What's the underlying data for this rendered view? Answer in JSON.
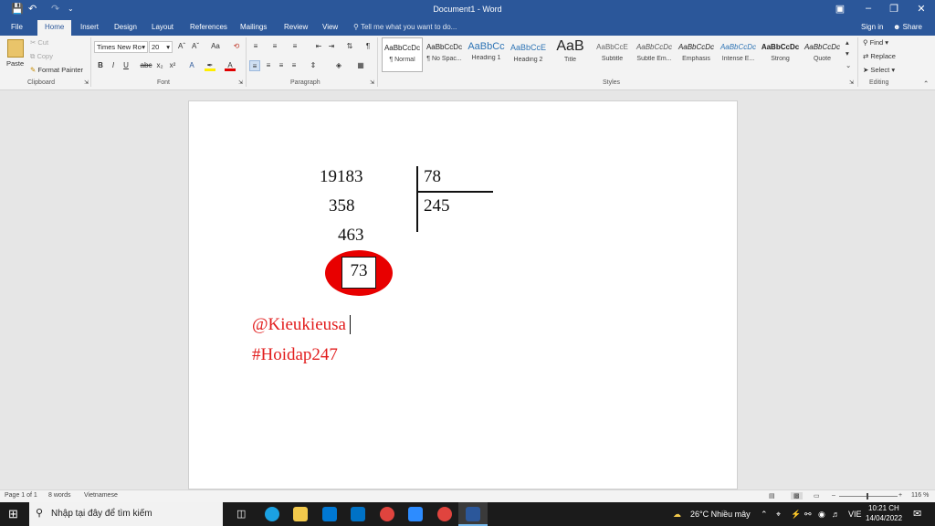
{
  "window": {
    "title": "Document1 - Word",
    "quick_access": [
      "save-icon",
      "undo-icon",
      "redo-icon",
      "customize-icon"
    ]
  },
  "tabs": [
    "File",
    "Home",
    "Insert",
    "Design",
    "Layout",
    "References",
    "Mailings",
    "Review",
    "View"
  ],
  "tell_me": "Tell me what you want to do...",
  "account": {
    "signin": "Sign in",
    "share": "Share"
  },
  "ribbon": {
    "clipboard": {
      "paste": "Paste",
      "cut": "Cut",
      "copy": "Copy",
      "format_painter": "Format Painter",
      "label": "Clipboard"
    },
    "font": {
      "name": "Times New Ro",
      "size": "20",
      "label": "Font"
    },
    "paragraph": {
      "label": "Paragraph"
    },
    "styles": {
      "label": "Styles",
      "items": [
        {
          "preview": "AaBbCcDc",
          "name": "¶ Normal"
        },
        {
          "preview": "AaBbCcDc",
          "name": "¶ No Spac..."
        },
        {
          "preview": "AaBbCc",
          "name": "Heading 1"
        },
        {
          "preview": "AaBbCcE",
          "name": "Heading 2"
        },
        {
          "preview": "AaB",
          "name": "Title"
        },
        {
          "preview": "AaBbCcE",
          "name": "Subtitle"
        },
        {
          "preview": "AaBbCcDc",
          "name": "Subtle Em..."
        },
        {
          "preview": "AaBbCcDc",
          "name": "Emphasis"
        },
        {
          "preview": "AaBbCcDc",
          "name": "Intense E..."
        },
        {
          "preview": "AaBbCcDc",
          "name": "Strong"
        },
        {
          "preview": "AaBbCcDc",
          "name": "Quote"
        }
      ]
    },
    "editing": {
      "find": "Find",
      "replace": "Replace",
      "select": "Select",
      "label": "Editing"
    }
  },
  "document": {
    "dividend": "19183",
    "divisor": "78",
    "step1": "358",
    "quotient": "245",
    "step2": "463",
    "remainder": "73",
    "line1": "@Kieukieusa",
    "line2": "#Hoidap247",
    "colors": {
      "highlight": "#e80000",
      "signature": "#e21d1d"
    }
  },
  "status": {
    "page": "Page 1 of 1",
    "words": "8 words",
    "language": "Vietnamese",
    "zoom": "116 %"
  },
  "taskbar": {
    "search_placeholder": "Nhập tại đây để tìm kiếm",
    "weather": "26°C  Nhiều mây",
    "input_lang": "VIE",
    "time": "10:21 CH",
    "date": "14/04/2022"
  }
}
